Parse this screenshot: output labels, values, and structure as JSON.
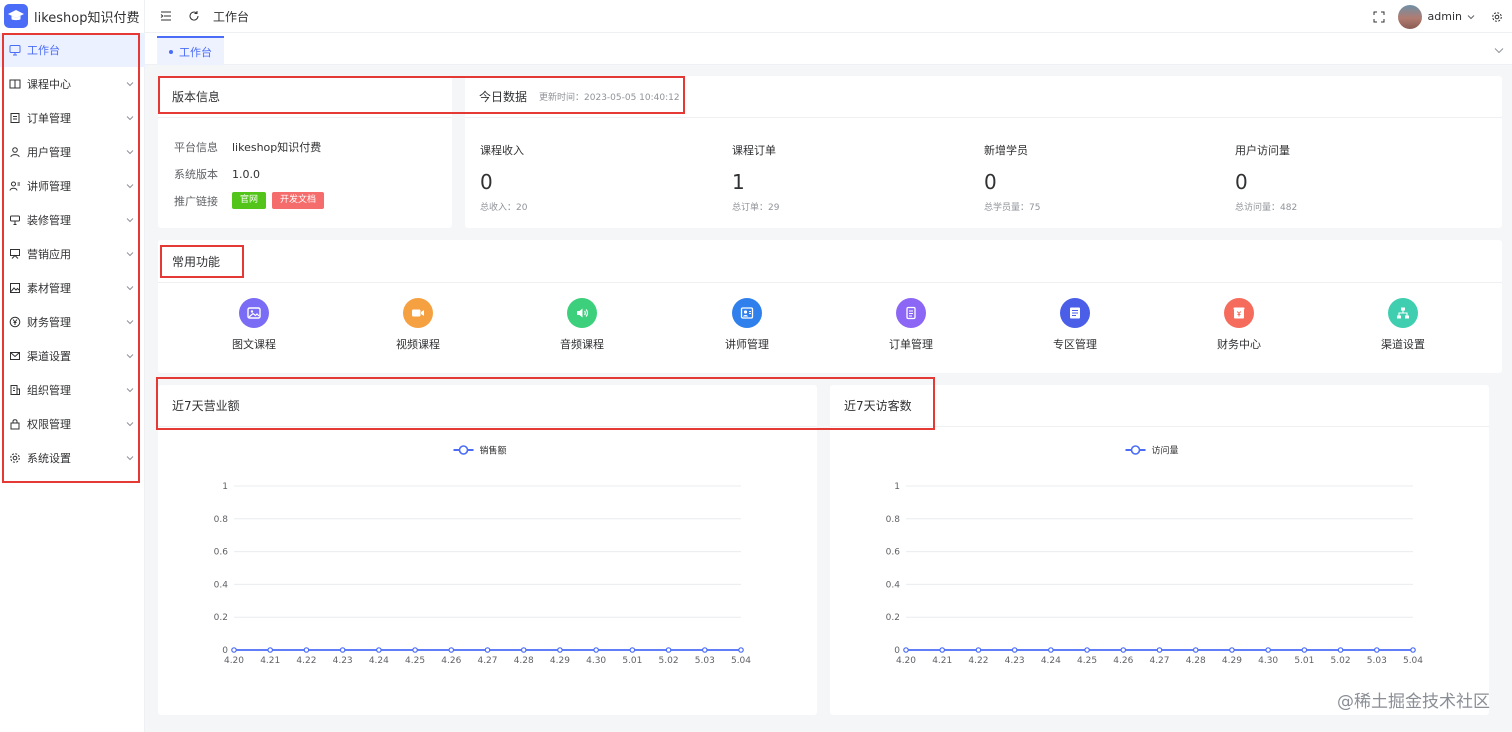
{
  "app": {
    "logo_text": "likeshop知识付费"
  },
  "sidebar": {
    "items": [
      {
        "label": "工作台",
        "icon": "monitor-icon",
        "active": true
      },
      {
        "label": "课程中心",
        "icon": "book-icon"
      },
      {
        "label": "订单管理",
        "icon": "order-icon"
      },
      {
        "label": "用户管理",
        "icon": "user-icon"
      },
      {
        "label": "讲师管理",
        "icon": "teacher-icon"
      },
      {
        "label": "装修管理",
        "icon": "decorate-icon"
      },
      {
        "label": "营销应用",
        "icon": "marketing-icon"
      },
      {
        "label": "素材管理",
        "icon": "image-icon"
      },
      {
        "label": "财务管理",
        "icon": "yen-icon"
      },
      {
        "label": "渠道设置",
        "icon": "mail-icon"
      },
      {
        "label": "组织管理",
        "icon": "building-icon"
      },
      {
        "label": "权限管理",
        "icon": "lock-icon"
      },
      {
        "label": "系统设置",
        "icon": "gear-icon"
      }
    ]
  },
  "header": {
    "breadcrumb": "工作台",
    "user_name": "admin"
  },
  "tabs": [
    {
      "label": "工作台",
      "active": true
    }
  ],
  "version_card": {
    "title": "版本信息",
    "platform_label": "平台信息",
    "platform_value": "likeshop知识付费",
    "version_label": "系统版本",
    "version_value": "1.0.0",
    "promo_label": "推广链接",
    "official_button": "官网",
    "docs_button": "开发文档",
    "official_color": "#52c41a",
    "docs_color": "#f56c6c"
  },
  "today_card": {
    "title": "今日数据",
    "update_time": "更新时间：2023-05-05 10:40:12",
    "stats": [
      {
        "title": "课程收入",
        "value": "0",
        "sub": "总收入：20"
      },
      {
        "title": "课程订单",
        "value": "1",
        "sub": "总订单：29"
      },
      {
        "title": "新增学员",
        "value": "0",
        "sub": "总学员量：75"
      },
      {
        "title": "用户访问量",
        "value": "0",
        "sub": "总访问量：482"
      }
    ]
  },
  "functions_card": {
    "title": "常用功能",
    "items": [
      {
        "label": "图文课程",
        "icon": "image-text-icon",
        "color": "#7b6cf6"
      },
      {
        "label": "视频课程",
        "icon": "video-icon",
        "color": "#f5a142"
      },
      {
        "label": "音频课程",
        "icon": "audio-icon",
        "color": "#3ccf7c"
      },
      {
        "label": "讲师管理",
        "icon": "teacher-card-icon",
        "color": "#2f80ed"
      },
      {
        "label": "订单管理",
        "icon": "order-list-icon",
        "color": "#8c67f5"
      },
      {
        "label": "专区管理",
        "icon": "zone-icon",
        "color": "#4a5ee8"
      },
      {
        "label": "财务中心",
        "icon": "finance-icon",
        "color": "#f56c5c"
      },
      {
        "label": "渠道设置",
        "icon": "channel-icon",
        "color": "#3fcfb0"
      }
    ]
  },
  "charts": {
    "sales": {
      "title": "近7天营业额"
    },
    "visitors": {
      "title": "近7天访客数"
    }
  },
  "chart_data": [
    {
      "type": "line",
      "title": "近7天营业额",
      "categories": [
        "4.20",
        "4.21",
        "4.22",
        "4.23",
        "4.24",
        "4.25",
        "4.26",
        "4.27",
        "4.28",
        "4.29",
        "4.30",
        "5.01",
        "5.02",
        "5.03",
        "5.04"
      ],
      "series": [
        {
          "name": "销售额",
          "values": [
            0,
            0,
            0,
            0,
            0,
            0,
            0,
            0,
            0,
            0,
            0,
            0,
            0,
            0,
            0
          ]
        }
      ],
      "yticks": [
        "0",
        "0.2",
        "0.4",
        "0.6",
        "0.8",
        "1"
      ],
      "ylim": [
        0,
        1
      ],
      "grid": true,
      "legend": "top-center",
      "color": "#4a6cf7"
    },
    {
      "type": "line",
      "title": "近7天访客数",
      "categories": [
        "4.20",
        "4.21",
        "4.22",
        "4.23",
        "4.24",
        "4.25",
        "4.26",
        "4.27",
        "4.28",
        "4.29",
        "4.30",
        "5.01",
        "5.02",
        "5.03",
        "5.04"
      ],
      "series": [
        {
          "name": "访问量",
          "values": [
            0,
            0,
            0,
            0,
            0,
            0,
            0,
            0,
            0,
            0,
            0,
            0,
            0,
            0,
            0
          ]
        }
      ],
      "yticks": [
        "0",
        "0.2",
        "0.4",
        "0.6",
        "0.8",
        "1"
      ],
      "ylim": [
        0,
        1
      ],
      "grid": true,
      "legend": "top-center",
      "color": "#4a6cf7"
    }
  ],
  "watermark": "@稀土掘金技术社区"
}
